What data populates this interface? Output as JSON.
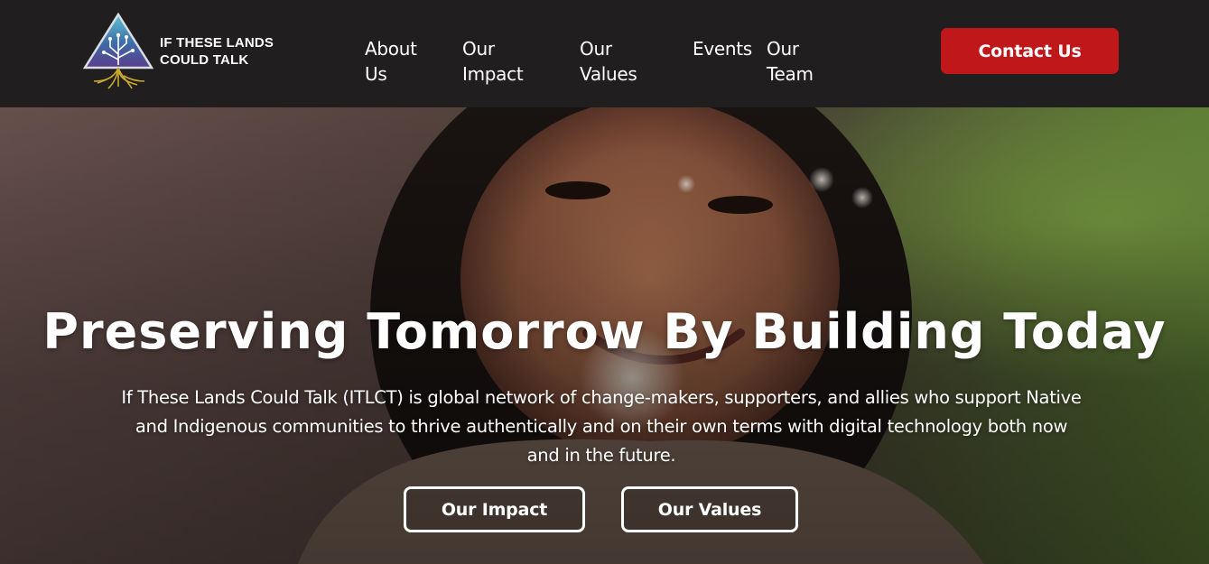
{
  "brand": {
    "name_line1": "IF THESE LANDS",
    "name_line2": "COULD TALK",
    "logo_icon": "triangle-circuit-roots-logo"
  },
  "nav": {
    "items": [
      {
        "label": "About Us"
      },
      {
        "label": "Our Impact"
      },
      {
        "label": "Our Values"
      },
      {
        "label": "Events"
      },
      {
        "label": "Our Team"
      }
    ],
    "contact_label": "Contact Us"
  },
  "hero": {
    "title": "Preserving Tomorrow By Building Today",
    "description": "If These Lands Could Talk (ITLCT) is global network of change-makers, supporters, and allies who support Native and Indigenous communities to thrive authentically and on their own terms with digital technology both now and in the future.",
    "buttons": [
      {
        "label": "Our Impact"
      },
      {
        "label": "Our Values"
      }
    ]
  },
  "colors": {
    "header_bg": "#201e1f",
    "accent_red": "#c0171b",
    "text": "#ffffff"
  }
}
